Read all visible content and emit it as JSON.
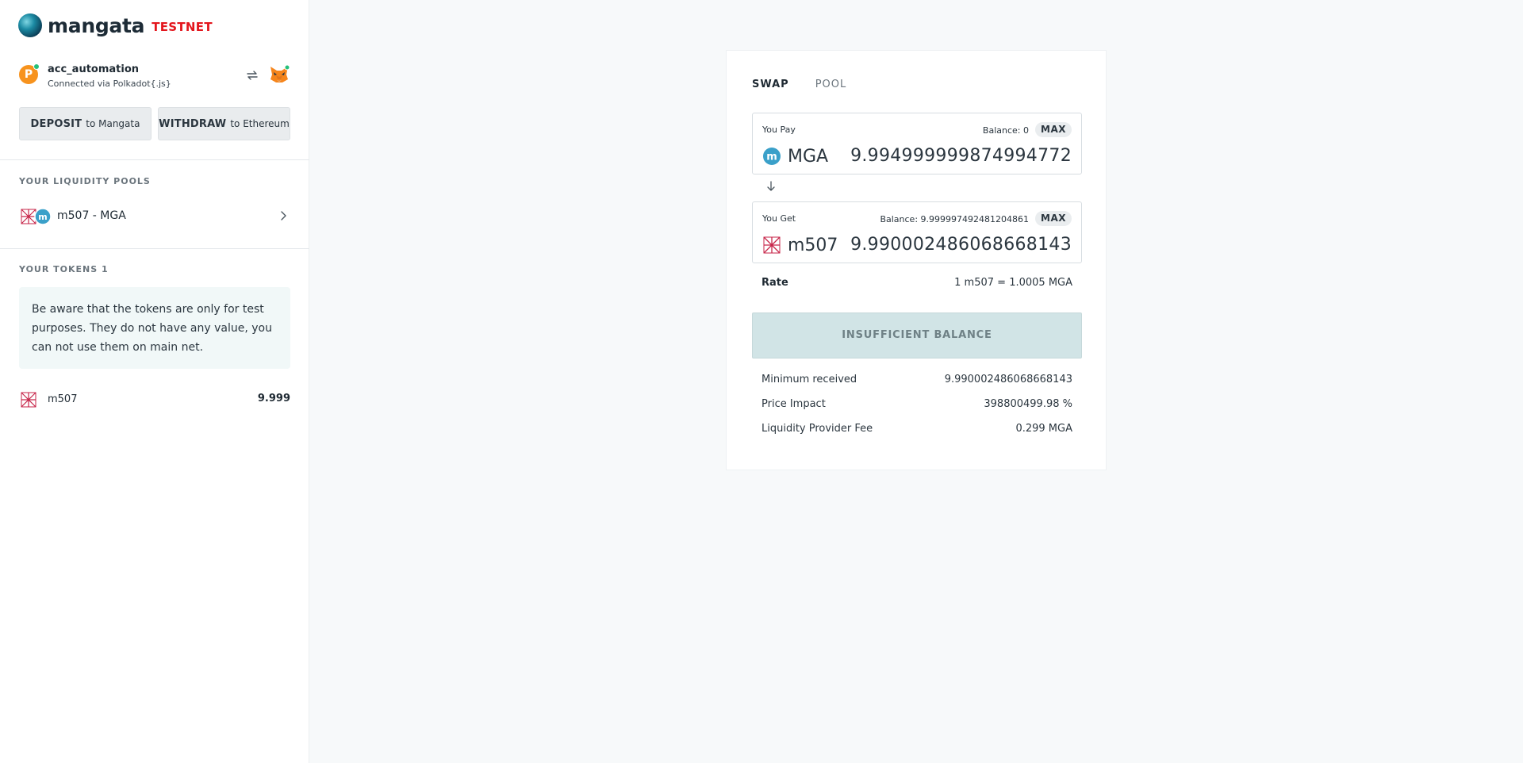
{
  "brand": {
    "name": "mangata",
    "badge": "TESTNET"
  },
  "account": {
    "name": "acc_automation",
    "connection": "Connected via Polkadot{.js}"
  },
  "actions": {
    "deposit": {
      "bold": "DEPOSIT",
      "suffix": "to Mangata"
    },
    "withdraw": {
      "bold": "WITHDRAW",
      "suffix": "to Ethereum"
    }
  },
  "liquidity": {
    "title": "YOUR LIQUIDITY POOLS",
    "pools": [
      {
        "label": "m507 - MGA"
      }
    ]
  },
  "tokens": {
    "title": "YOUR TOKENS 1",
    "notice": "Be aware that the tokens are only for test purposes. They do not have any value, you can not use them on main net.",
    "items": [
      {
        "symbol": "m507",
        "amount": "9.999"
      }
    ]
  },
  "swap": {
    "tabs": [
      {
        "label": "SWAP",
        "active": true
      },
      {
        "label": "POOL",
        "active": false
      }
    ],
    "pay": {
      "label": "You Pay",
      "balance": "Balance: 0",
      "max": "MAX",
      "symbol": "MGA",
      "amount": "9.994999999874994772"
    },
    "get": {
      "label": "You Get",
      "balance": "Balance: 9.999997492481204861",
      "max": "MAX",
      "symbol": "m507",
      "amount": "9.990002486068668143"
    },
    "rate": {
      "label": "Rate",
      "value": "1 m507 = 1.0005 MGA"
    },
    "submit": "INSUFFICIENT BALANCE",
    "details": [
      {
        "label": "Minimum received",
        "value": "9.990002486068668143"
      },
      {
        "label": "Price Impact",
        "value": "398800499.98 %"
      },
      {
        "label": "Liquidity Provider Fee",
        "value": "0.299 MGA"
      }
    ]
  },
  "colors": {
    "accent": "#e3161d",
    "submit_disabled": "#d1e4e6",
    "notice_bg": "#f1f8f8"
  }
}
